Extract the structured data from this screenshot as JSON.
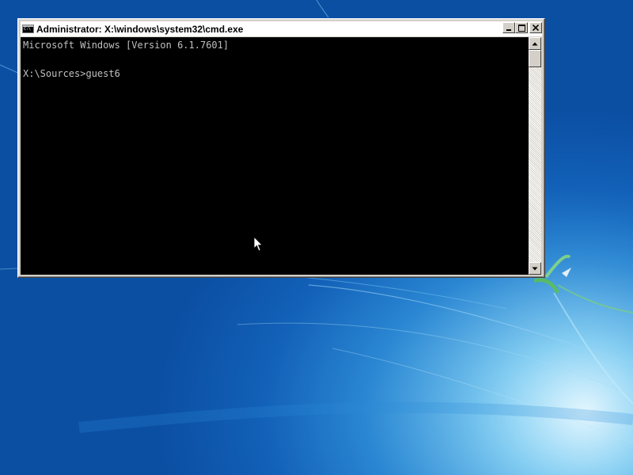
{
  "window": {
    "title": "Administrator: X:\\windows\\system32\\cmd.exe",
    "icon": "console-app-icon",
    "buttons": {
      "minimize_icon": "minimize-icon",
      "maximize_icon": "maximize-icon",
      "close_icon": "close-icon"
    }
  },
  "console": {
    "lines": [
      "Microsoft Windows [Version 6.1.7601]",
      "",
      "X:\\Sources>guest6"
    ],
    "text_color": "#c0c0c0",
    "background_color": "#000000"
  },
  "desktop": {
    "wallpaper": "windows-7-default-blue"
  },
  "cursor": {
    "icon": "arrow-cursor-icon"
  }
}
